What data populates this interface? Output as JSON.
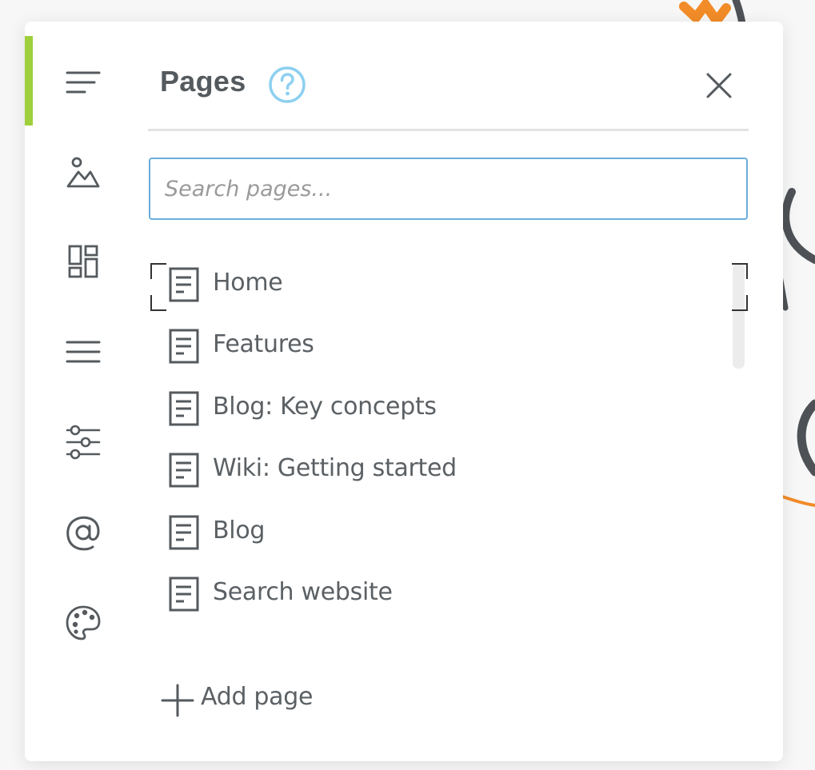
{
  "panel": {
    "title": "Pages",
    "help_icon": "help-circle-icon",
    "close_icon": "close-icon",
    "accent_color": "#9fd03b",
    "help_color": "#8dd0f0",
    "search_border_color": "#6aaedb"
  },
  "sidebar": {
    "items": [
      {
        "icon": "pages-lines-icon",
        "active": true
      },
      {
        "icon": "image-icon"
      },
      {
        "icon": "layout-blocks-icon"
      },
      {
        "icon": "menu-icon"
      },
      {
        "icon": "sliders-icon"
      },
      {
        "icon": "at-sign-icon"
      },
      {
        "icon": "palette-icon"
      }
    ]
  },
  "search": {
    "placeholder": "Search pages...",
    "value": ""
  },
  "pages": [
    {
      "label": "Home",
      "icon": "document-icon",
      "selected": true
    },
    {
      "label": "Features",
      "icon": "document-icon"
    },
    {
      "label": "Blog: Key concepts",
      "icon": "document-icon"
    },
    {
      "label": "Wiki: Getting started",
      "icon": "document-icon"
    },
    {
      "label": "Blog",
      "icon": "document-icon"
    },
    {
      "label": "Search website",
      "icon": "document-icon"
    }
  ],
  "add_page": {
    "label": "Add page",
    "icon": "plus-icon"
  }
}
